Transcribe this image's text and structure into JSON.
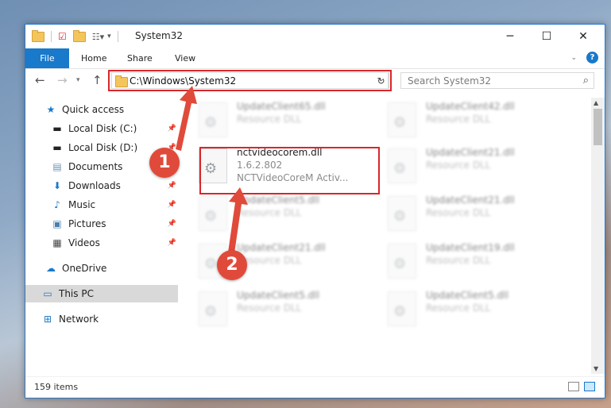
{
  "window": {
    "title": "System32",
    "controls": {
      "minimize": "─",
      "maximize": "☐",
      "close": "✕"
    }
  },
  "ribbon": {
    "tabs": [
      {
        "label": "File"
      },
      {
        "label": "Home"
      },
      {
        "label": "Share"
      },
      {
        "label": "View"
      }
    ],
    "expand_icon": "chevron-down-icon",
    "help_label": "?"
  },
  "address": {
    "path": "C:\\Windows\\System32",
    "search_placeholder": "Search System32"
  },
  "nav_pane": {
    "items": [
      {
        "label": "Quick access",
        "icon": "star-icon",
        "pinned": false
      },
      {
        "label": "Local Disk (C:)",
        "icon": "drive-icon",
        "pinned": true
      },
      {
        "label": "Local Disk (D:)",
        "icon": "drive-icon",
        "pinned": true
      },
      {
        "label": "Documents",
        "icon": "documents-icon",
        "pinned": true
      },
      {
        "label": "Downloads",
        "icon": "download-icon",
        "pinned": true
      },
      {
        "label": "Music",
        "icon": "music-icon",
        "pinned": true
      },
      {
        "label": "Pictures",
        "icon": "pictures-icon",
        "pinned": true
      },
      {
        "label": "Videos",
        "icon": "videos-icon",
        "pinned": true
      },
      {
        "label": "OneDrive",
        "icon": "cloud-icon",
        "pinned": false
      },
      {
        "label": "This PC",
        "icon": "computer-icon",
        "pinned": false,
        "selected": true
      },
      {
        "label": "Network",
        "icon": "network-icon",
        "pinned": false
      }
    ]
  },
  "files": {
    "highlighted": {
      "name": "nctvideocorem.dll",
      "version": "1.6.2.802",
      "description": "NCTVideoCoreM Activ..."
    },
    "blurred": [
      {
        "name": "UpdateClient65.dll",
        "type": "Resource DLL"
      },
      {
        "name": "UpdateClient42.dll",
        "type": "Resource DLL"
      },
      {
        "name": "UpdateClient21.dll",
        "type": "Resource DLL"
      },
      {
        "name": "UpdateClient5.dll",
        "type": "Resource DLL"
      },
      {
        "name": "UpdateClient21.dll",
        "type": "Resource DLL"
      },
      {
        "name": "UpdateClient21.dll",
        "type": "Resource DLL"
      },
      {
        "name": "UpdateClient19.dll",
        "type": "Resource DLL"
      },
      {
        "name": "UpdateClient5.dll",
        "type": "Resource DLL"
      },
      {
        "name": "UpdateClient5.dll",
        "type": "Resource DLL"
      }
    ]
  },
  "status": {
    "item_count": "159 items"
  },
  "callouts": {
    "one": "1",
    "two": "2"
  },
  "colors": {
    "accent": "#1979ca",
    "highlight": "#d9262b",
    "callout": "#e04a3a"
  }
}
